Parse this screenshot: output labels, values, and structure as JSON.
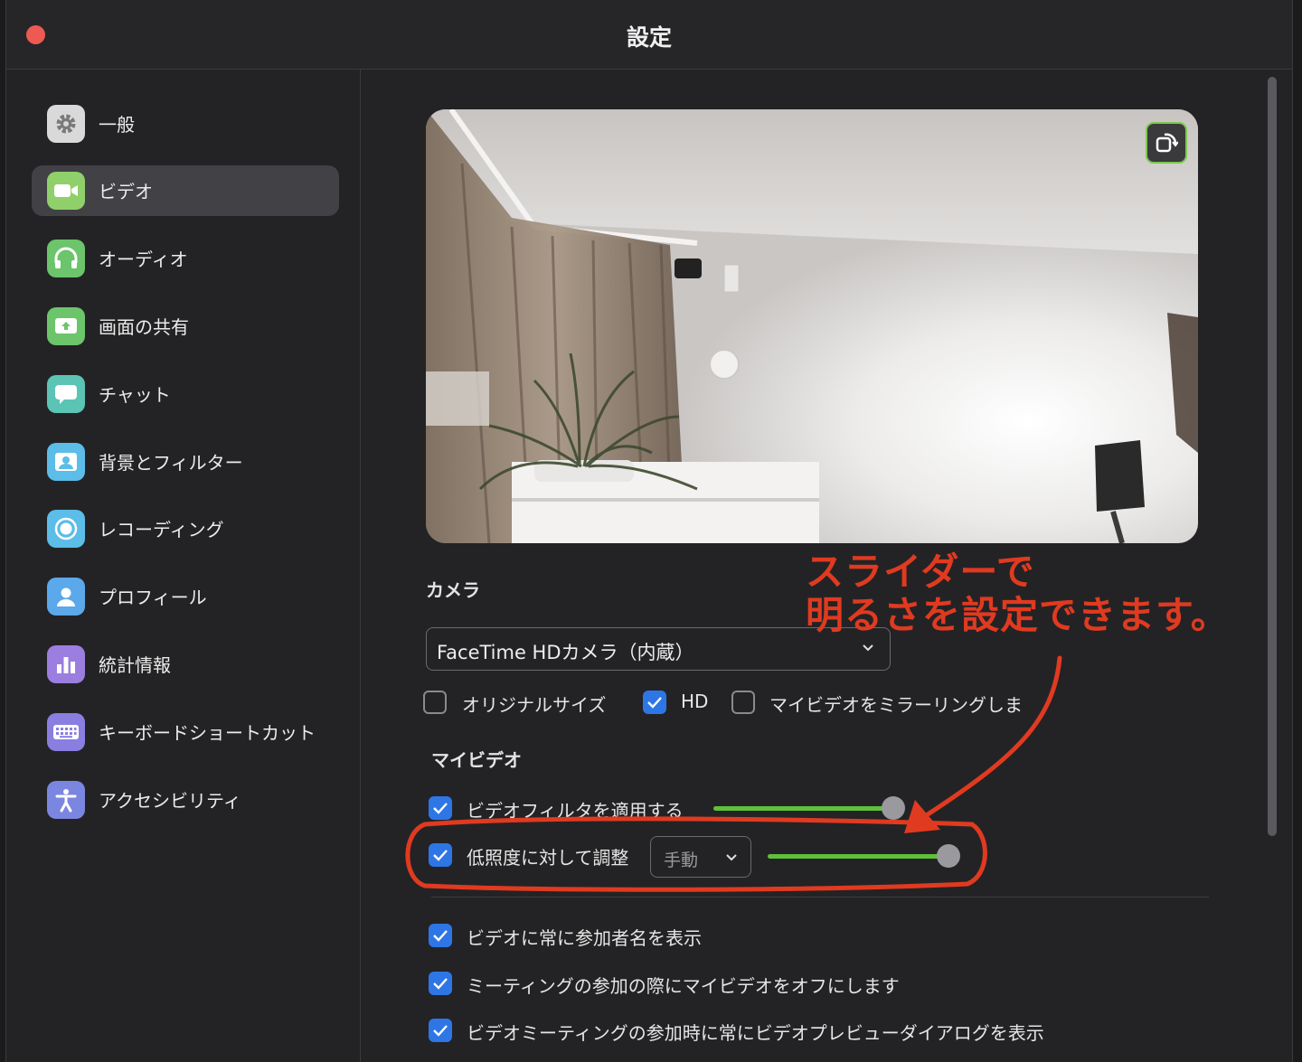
{
  "window": {
    "title": "設定"
  },
  "sidebar": {
    "items": [
      {
        "label": "一般",
        "icon": "gear-icon",
        "color": "#d9d9d9"
      },
      {
        "label": "ビデオ",
        "icon": "video-camera-icon",
        "color": "#8fd06a",
        "active": true
      },
      {
        "label": "オーディオ",
        "icon": "headphones-icon",
        "color": "#6cc46b"
      },
      {
        "label": "画面の共有",
        "icon": "share-screen-icon",
        "color": "#6cc46b"
      },
      {
        "label": "チャット",
        "icon": "chat-bubble-icon",
        "color": "#5cc4b4"
      },
      {
        "label": "背景とフィルター",
        "icon": "background-person-icon",
        "color": "#5bbde8"
      },
      {
        "label": "レコーディング",
        "icon": "record-icon",
        "color": "#5bbde8"
      },
      {
        "label": "プロフィール",
        "icon": "profile-icon",
        "color": "#5ba8ea"
      },
      {
        "label": "統計情報",
        "icon": "bar-chart-icon",
        "color": "#9b7ee0"
      },
      {
        "label": "キーボードショートカット",
        "icon": "keyboard-icon",
        "color": "#8a7ee0"
      },
      {
        "label": "アクセシビリティ",
        "icon": "accessibility-icon",
        "color": "#7b86e0"
      }
    ]
  },
  "camera": {
    "section_label": "カメラ",
    "device": "FaceTime HDカメラ（内蔵）",
    "original_size": {
      "label": "オリジナルサイズ",
      "checked": false
    },
    "hd": {
      "label": "HD",
      "checked": true
    },
    "mirror": {
      "label": "マイビデオをミラーリングしま"
    }
  },
  "my_video": {
    "section_label": "マイビデオ",
    "apply_filter": {
      "label": "ビデオフィルタを適用する",
      "checked": true,
      "slider_level": 0.97
    },
    "low_light": {
      "label": "低照度に対して調整",
      "checked": true,
      "mode": "手動",
      "slider_level": 1.0
    }
  },
  "options": [
    {
      "label": "ビデオに常に参加者名を表示",
      "checked": true
    },
    {
      "label": "ミーティングの参加の際にマイビデオをオフにします",
      "checked": true
    },
    {
      "label": "ビデオミーティングの参加時に常にビデオプレビューダイアログを表示",
      "checked": true
    }
  ],
  "annotation": {
    "line1": "スライダーで",
    "line2": "明るさを設定できます。",
    "color": "#e03a20"
  }
}
